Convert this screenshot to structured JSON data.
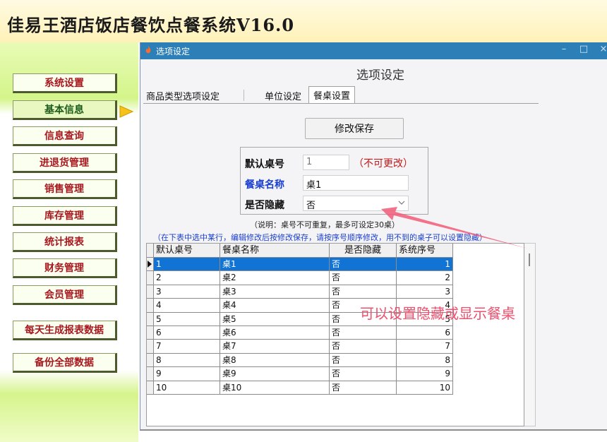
{
  "app": {
    "title": "佳易王酒店饭店餐饮点餐系统V16.0"
  },
  "nav": {
    "items": [
      {
        "label": "系统设置"
      },
      {
        "label": "基本信息"
      },
      {
        "label": "信息查询"
      },
      {
        "label": "进退货管理"
      },
      {
        "label": "销售管理"
      },
      {
        "label": "库存管理"
      },
      {
        "label": "统计报表"
      },
      {
        "label": "财务管理"
      },
      {
        "label": "会员管理"
      },
      {
        "label": "每天生成报表数据"
      },
      {
        "label": "备份全部数据"
      }
    ],
    "active_index": 1
  },
  "window": {
    "title": "选项设定",
    "controls": {
      "minimize": "–",
      "maximize": "□",
      "close": "×"
    }
  },
  "panel": {
    "title": "选项设定",
    "tabs": [
      {
        "label": "商品类型选项设定"
      },
      {
        "label": "单位设定"
      },
      {
        "label": "餐桌设置"
      }
    ],
    "active_tab": 2
  },
  "form": {
    "save_label": "修改保存",
    "default_no_label": "默认桌号",
    "default_no_value": "1",
    "default_no_note": "（不可更改）",
    "name_label": "餐桌名称",
    "name_value": "桌1",
    "hidden_label": "是否隐藏",
    "hidden_value": "否",
    "hint1": "（说明：桌号不可重复，最多可设定30桌）",
    "hint2": "（在下表中选中某行，编辑修改后按修改保存，请按序号顺序修改，用不到的桌子可以设置隐藏）"
  },
  "table": {
    "columns": [
      "默认桌号",
      "餐桌名称",
      "是否隐藏",
      "系统序号"
    ],
    "rows": [
      [
        "1",
        "桌1",
        "否",
        "1"
      ],
      [
        "2",
        "桌2",
        "否",
        "2"
      ],
      [
        "3",
        "桌3",
        "否",
        "3"
      ],
      [
        "4",
        "桌4",
        "否",
        "4"
      ],
      [
        "5",
        "桌5",
        "否",
        "5"
      ],
      [
        "6",
        "桌6",
        "否",
        "6"
      ],
      [
        "7",
        "桌7",
        "否",
        "7"
      ],
      [
        "8",
        "桌8",
        "否",
        "8"
      ],
      [
        "9",
        "桌9",
        "否",
        "9"
      ],
      [
        "10",
        "桌10",
        "否",
        "10"
      ]
    ],
    "selected_row": 0
  },
  "annotation": {
    "text": "可以设置隐藏或显示餐桌",
    "color": "#f0506e"
  },
  "colors": {
    "titlebar": "#2d7fb8",
    "selection": "#1173d4",
    "nav_text": "#a8181f"
  },
  "icons": {
    "window_icon": "flame-icon",
    "nav_arrow": "arrow-right-icon",
    "select": "chevron-down-icon"
  }
}
